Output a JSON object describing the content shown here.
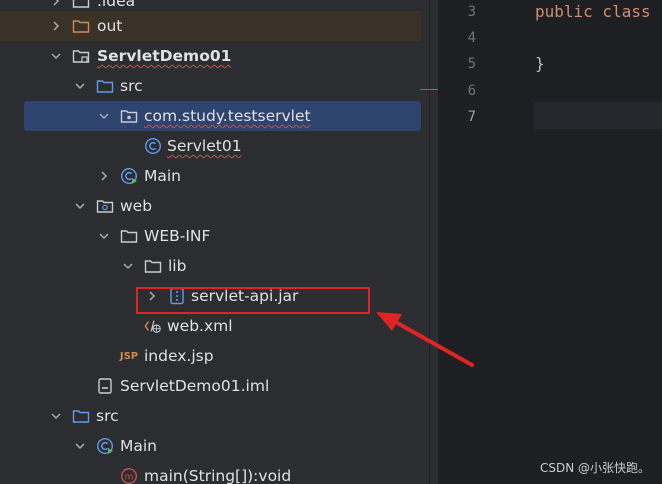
{
  "tree": {
    "rows": [
      {
        "label": ".idea"
      },
      {
        "label": "out"
      },
      {
        "label": "ServletDemo01"
      },
      {
        "label": "src"
      },
      {
        "label": "com.study.testservlet"
      },
      {
        "label": "Servlet01"
      },
      {
        "label": "Main"
      },
      {
        "label": "web"
      },
      {
        "label": "WEB-INF"
      },
      {
        "label": "lib"
      },
      {
        "label": "servlet-api.jar"
      },
      {
        "label": "web.xml"
      },
      {
        "label": "index.jsp"
      },
      {
        "label": "ServletDemo01.iml"
      },
      {
        "label": "src"
      },
      {
        "label": "Main"
      },
      {
        "label": "main(String[]):void"
      }
    ]
  },
  "editor": {
    "lines": [
      {
        "num": "3",
        "text": "public class"
      },
      {
        "num": "4",
        "text": ""
      },
      {
        "num": "5",
        "text": "}"
      },
      {
        "num": "6",
        "text": ""
      },
      {
        "num": "7",
        "text": ""
      }
    ]
  },
  "icons": {
    "folder": "folder-icon",
    "module": "module-folder-icon",
    "package": "package-icon",
    "class": "class-icon",
    "main-class": "main-class-icon",
    "jar": "jar-library-icon",
    "xml": "xml-file-icon",
    "jsp": "jsp-file-icon",
    "iml": "iml-file-icon",
    "method": "method-icon"
  },
  "colors": {
    "selection": "#2e436e",
    "annotation": "#e02424",
    "keyword": "#cf8e6d",
    "error_underline": "#c94f4f"
  },
  "watermark": "CSDN @小张快跑。"
}
